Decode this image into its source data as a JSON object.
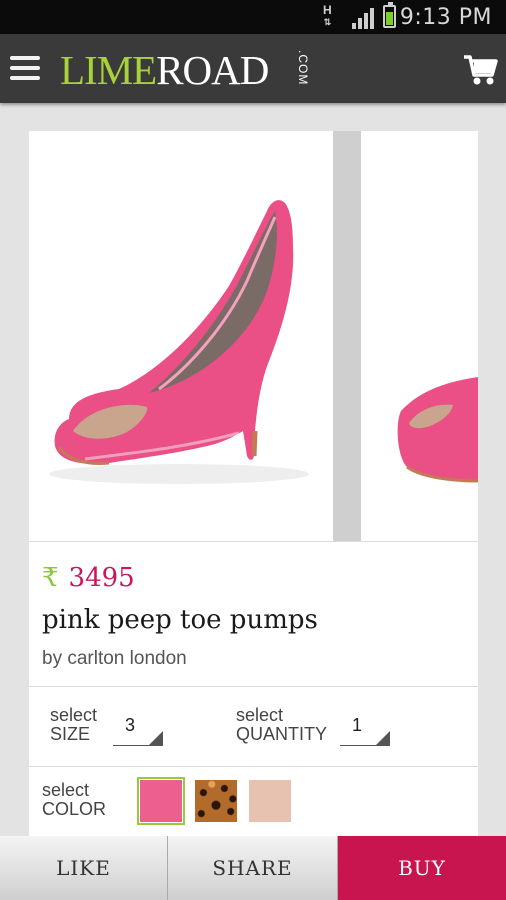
{
  "status_bar": {
    "network": "H",
    "time": "9:13 PM"
  },
  "app_bar": {
    "logo_lime": "LIME",
    "logo_road": "ROAD",
    "logo_com": ".COM"
  },
  "product": {
    "currency_symbol": "₹",
    "price": "3495",
    "title": "pink peep toe pumps",
    "brand": "by carlton london"
  },
  "options": {
    "size_label_top": "select",
    "size_label_bottom": "SIZE",
    "size_value": "3",
    "quantity_label_top": "select",
    "quantity_label_bottom": "QUANTITY",
    "quantity_value": "1",
    "color_label_top": "select",
    "color_label_bottom": "COLOR",
    "colors": [
      "pink",
      "leopard",
      "nude"
    ],
    "selected_color": "pink"
  },
  "actions": {
    "like_label": "LIKE",
    "share_label": "SHARE",
    "buy_label": "BUY"
  },
  "theme": {
    "brand_green": "#a8d13a",
    "price_color": "#c9165d",
    "buy_color": "#c8154f"
  }
}
